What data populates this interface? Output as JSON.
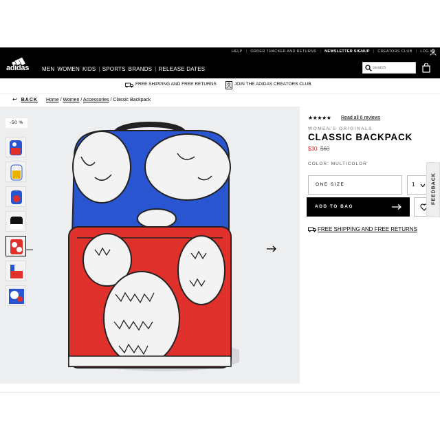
{
  "header": {
    "brand": "adidas",
    "utility_links": [
      "HELP",
      "ORDER TRACKER AND RETURNS",
      "NEWSLETTER SIGNUP",
      "CREATORS CLUB",
      "LOG IN"
    ],
    "nav_left": [
      "MEN",
      "WOMEN",
      "KIDS"
    ],
    "nav_right": [
      "SPORTS",
      "BRANDS",
      "RELEASE DATES"
    ],
    "search_placeholder": "Search"
  },
  "promo": {
    "shipping": "FREE SHIPPING AND FREE RETURNS",
    "club": "JOIN THE ADIDAS CREATORS CLUB"
  },
  "breadcrumb": {
    "back": "BACK",
    "items": [
      "Home",
      "Women",
      "Accessories"
    ],
    "current": "Classic Backpack"
  },
  "gallery": {
    "badge": "-50 %",
    "thumbnail_count": 7,
    "selected_thumbnail": 5
  },
  "product": {
    "rating_stars": "★★★★★",
    "reviews_link": "Read all 6 reviews",
    "category": "WOMEN'S ORIGINALS",
    "title": "CLASSIC BACKPACK",
    "price_now": "$30",
    "price_old": "$60",
    "color": "COLOR: MULTICOLOR",
    "size": "ONE SIZE",
    "quantity": "1",
    "add_to_bag": "ADD TO BAG",
    "shipping_link": "FREE SHIPPING AND FREE RETURNS"
  },
  "feedback_tab": "FEEDBACK",
  "colors": {
    "header_bg": "#000000",
    "gallery_bg": "#edeef0",
    "sale_price": "#dd2222",
    "bag_blue": "#2a55d0",
    "bag_red": "#e0302c"
  }
}
